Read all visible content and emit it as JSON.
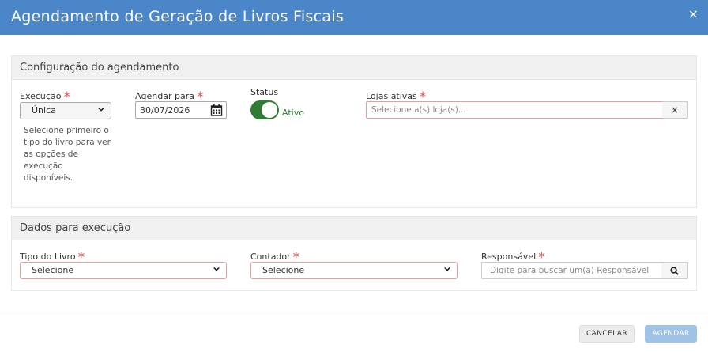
{
  "header": {
    "title": "Agendamento de Geração de Livros Fiscais",
    "close_icon": "×"
  },
  "config": {
    "title": "Configuração do agendamento",
    "execucao": {
      "label": "Execução",
      "value": "Única",
      "help": [
        "Selecione primeiro o",
        "tipo do livro para ver",
        "as opções de",
        "execução",
        "disponíveis."
      ]
    },
    "agendar": {
      "label": "Agendar para",
      "value": "30/07/2026"
    },
    "status": {
      "label": "Status",
      "state": "Ativo",
      "on": true
    },
    "lojas": {
      "label": "Lojas ativas",
      "placeholder": "Selecione a(s) loja(s)...",
      "clear": "×"
    }
  },
  "execucao": {
    "title": "Dados para execução",
    "tipo": {
      "label": "Tipo do Livro",
      "value": "Selecione"
    },
    "contador": {
      "label": "Contador",
      "value": "Selecione"
    },
    "responsavel": {
      "label": "Responsável",
      "placeholder": "Digite para buscar um(a) Responsável"
    }
  },
  "footer": {
    "cancel": "CANCELAR",
    "submit": "AGENDAR"
  },
  "colors": {
    "header": "#4a86c8",
    "toggle_on": "#2e7d32",
    "required": "#d9534f",
    "submit_disabled": "#9fc3e6"
  }
}
